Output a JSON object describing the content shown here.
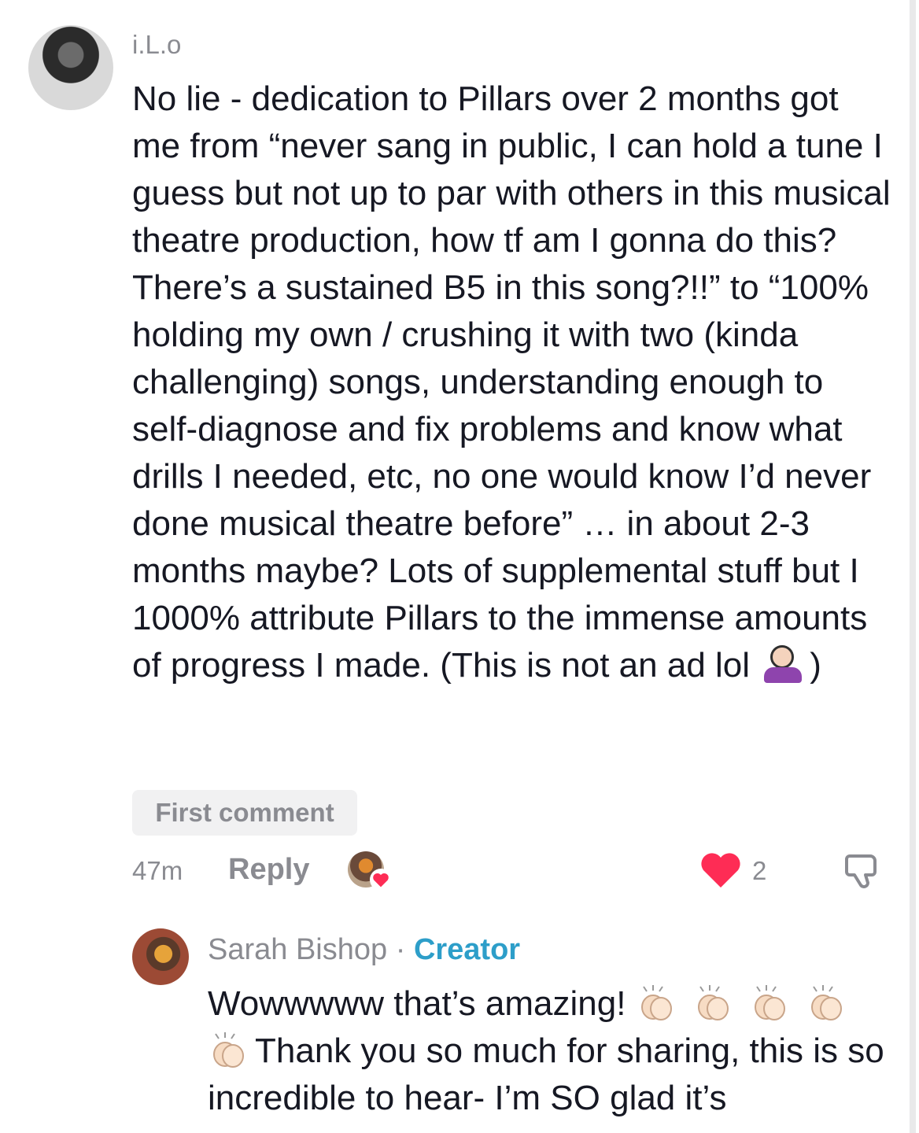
{
  "comment": {
    "username": "i.L.o",
    "text_before_emoji": "No lie - dedication to Pillars over 2 months got me from “never sang in public, I can hold a tune I guess but not up to par with others in this musical theatre production, how tf am I gonna do this? There’s a sustained B5 in this song?!!” to “100% holding my own / crushing it with two (kinda challenging) songs, understanding enough to self-diagnose and fix problems and know what drills I needed, etc, no one would know I’d never done musical theatre before” … in about 2-3 months maybe? Lots of supplemental stuff but I 1000% attribute Pillars to the immense amounts of progress I made. (This is not an ad lol ",
    "text_after_emoji": ")",
    "emoji_icon": "person-tipping-hand-emoji",
    "badge": "First comment",
    "time": "47m",
    "reply_label": "Reply",
    "like_count": "2",
    "like_color": "#fe2c55"
  },
  "reply": {
    "author": "Sarah Bishop",
    "separator": "·",
    "role": "Creator",
    "text_line1": "Wowwwww that’s amazing!",
    "text_line2": "Thank you so much for sharing, this is so incredible to hear- I’m SO glad it’s",
    "emoji_icon": "clapping-hands-emoji"
  },
  "colors": {
    "muted_text": "#8a8b91",
    "creator_blue": "#2d9ec9",
    "badge_bg": "#f1f1f2"
  }
}
